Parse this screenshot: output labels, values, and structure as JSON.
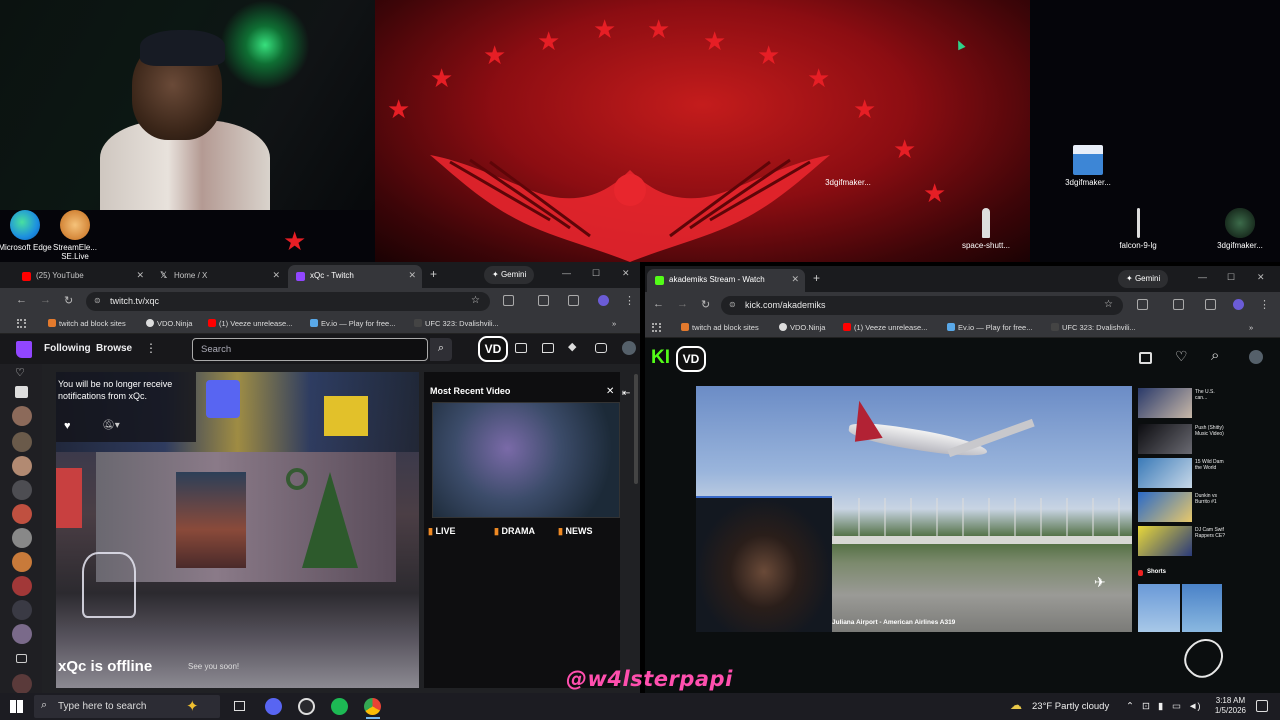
{
  "desktop": {
    "icons": [
      {
        "label": "Microsoft Edge",
        "color": "#1c8ee0"
      },
      {
        "label": "StreamEle... SE.Live",
        "color": "#f0a34a"
      },
      {
        "label": "3dgifmaker...",
        "color": "#3d86d6"
      },
      {
        "label": "3dgifmaker...",
        "color": "#3d86d6"
      },
      {
        "label": "space-shutt...",
        "color": "#999999"
      },
      {
        "label": "falcon-9-lg",
        "color": "#999999"
      },
      {
        "label": "3dgifmaker...",
        "color": "#3c6b4a"
      }
    ]
  },
  "left_browser": {
    "tabs": [
      {
        "label": "(25) YouTube",
        "icon": "youtube-icon",
        "color": "#ff0000"
      },
      {
        "label": "Home / X",
        "icon": "x-icon",
        "color": "#ffffff"
      },
      {
        "label": "xQc - Twitch",
        "icon": "twitch-icon",
        "color": "#9146ff"
      }
    ],
    "gemini_label": "Gemini",
    "url": "twitch.tv/xqc",
    "bookmarks": [
      "twitch ad block sites",
      "VDO.Ninja",
      "(1) Veeze unrelease...",
      "Ev.io — Play for free...",
      "UFC 323: Dvalishvili..."
    ],
    "twitch": {
      "following": "Following",
      "browse": "Browse",
      "search_placeholder": "Search",
      "notification_text": "You will be no longer receive notifications from xQc.",
      "offline_text": "xQc is offline",
      "see_you_text": "See you soon!",
      "panel_title": "Most Recent Video",
      "panel_tags": [
        "LIVE",
        "DRAMA",
        "NEWS"
      ]
    }
  },
  "right_browser": {
    "tabs": [
      {
        "label": "akademiks Stream - Watch",
        "icon": "kick-icon",
        "color": "#53fc18"
      }
    ],
    "gemini_label": "Gemini",
    "url": "kick.com/akademiks",
    "bookmarks": [
      "twitch ad block sites",
      "VDO.Ninja",
      "(1) Veeze unrelease...",
      "Ev.io — Play for free...",
      "UFC 323: Dvalishvili..."
    ],
    "kick": {
      "logo": "KI",
      "video_caption": "Juliana Airport - American Airlines A319",
      "shorts_label": "Shorts",
      "sidebar_videos": [
        "The U.S. can...",
        "Push (Shitty) Music Video)",
        "15 Wild Dam the World",
        "Dunkin vs Burrito #1",
        "DJ Cam Swif Rappers CE?"
      ]
    }
  },
  "overlay": {
    "watermark": "@w4lsterpapi",
    "vdo_badge": "VD"
  },
  "taskbar": {
    "search_placeholder": "Type here to search",
    "weather": "23°F  Partly cloudy",
    "time": "3:18 AM",
    "date": "1/5/2026"
  },
  "colors": {
    "twitch_purple": "#9146ff",
    "kick_green": "#53fc18",
    "wallpaper_red": "#b5161b",
    "watermark_pink": "#ff4fae"
  }
}
